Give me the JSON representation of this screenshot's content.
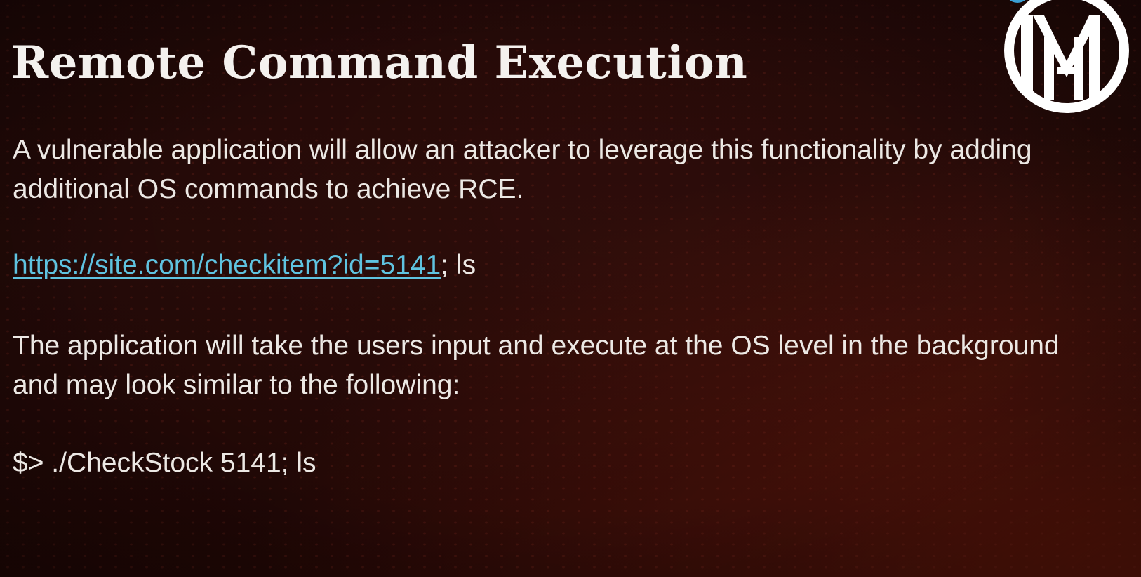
{
  "slide": {
    "title": "Remote Command Execution",
    "paragraph1": {
      "line1": "A vulnerable application will allow an attacker to leverage this functionality by adding",
      "line2": "additional OS commands to achieve RCE."
    },
    "example_url": {
      "link_text": "https://site.com/checkitem?id=5141",
      "suffix": "; ls"
    },
    "paragraph2": {
      "line1": "The application will take the users input and execute at the OS level in the background",
      "line2": "and may look similar to the following:"
    },
    "command": "$> ./CheckStock 5141; ls"
  },
  "colors": {
    "background": "#2b0b09",
    "text": "#ece8e4",
    "link": "#5fc3e0",
    "logo": "#ffffff"
  },
  "icons": {
    "logo": "mn-monogram-logo"
  }
}
